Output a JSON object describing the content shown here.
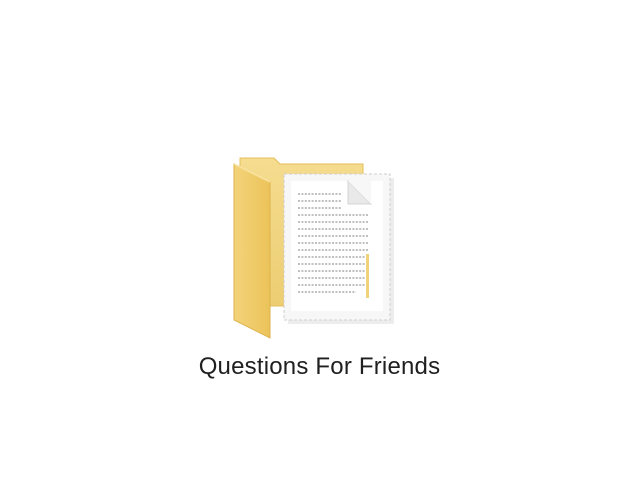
{
  "desktop": {
    "background": "#ffffff",
    "folder": {
      "name": "Questions For Friends",
      "icon": "folder-with-document-icon",
      "folder_color": "#f2cf6e",
      "folder_back_color": "#f0d98a"
    }
  }
}
